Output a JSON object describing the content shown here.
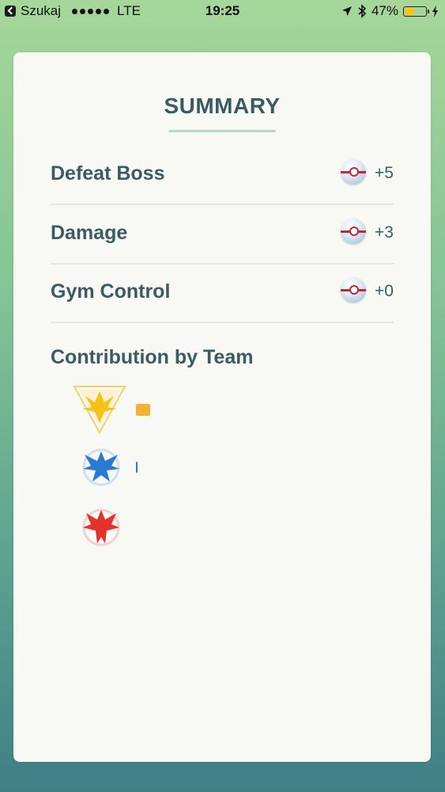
{
  "status_bar": {
    "back_label": "Szukaj",
    "carrier": "LTE",
    "time": "19:25",
    "battery": "47%",
    "battery_level": 0.47
  },
  "summary": {
    "title": "SUMMARY",
    "rows": [
      {
        "label": "Defeat Boss",
        "value": "+5"
      },
      {
        "label": "Damage",
        "value": "+3"
      },
      {
        "label": "Gym Control",
        "value": "+0"
      }
    ]
  },
  "contribution": {
    "title": "Contribution by Team",
    "teams": [
      {
        "name": "instinct",
        "color": "#f5b134",
        "share": 0.06
      },
      {
        "name": "mystic",
        "color": "#2a7ad1",
        "share": 0.005
      },
      {
        "name": "valor",
        "color": "#e2322b",
        "share": 0
      }
    ]
  },
  "colors": {
    "text": "#3b5b63",
    "accent_line": "#b9d8c2",
    "pokeball_red": "#b52b3a"
  }
}
